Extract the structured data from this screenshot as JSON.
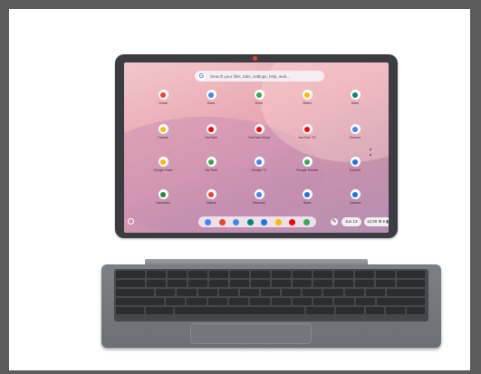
{
  "search": {
    "placeholder": "Search your files, tabs, settings, help, web..."
  },
  "apps": [
    {
      "label": "Gmail",
      "color": "#ea4335"
    },
    {
      "label": "Docs",
      "color": "#4285f4"
    },
    {
      "label": "Drive",
      "color": "#34a853"
    },
    {
      "label": "Slides",
      "color": "#fbbc04"
    },
    {
      "label": "Meet",
      "color": "#00897b"
    },
    {
      "label": "Photos",
      "color": "#fbbc04"
    },
    {
      "label": "YouTube",
      "color": "#ff0000"
    },
    {
      "label": "YouTube Music",
      "color": "#ff0000"
    },
    {
      "label": "YouTube TV",
      "color": "#ff0000"
    },
    {
      "label": "Chrome",
      "color": "#4285f4"
    },
    {
      "label": "Google Keep",
      "color": "#fbbc04"
    },
    {
      "label": "My Stuff",
      "color": "#34a853"
    },
    {
      "label": "Google TV",
      "color": "#4285f4"
    },
    {
      "label": "Google Sheets",
      "color": "#34a853"
    },
    {
      "label": "Explore",
      "color": "#1a73e8"
    },
    {
      "label": "Calculator",
      "color": "#1e8e3e"
    },
    {
      "label": "Videos",
      "color": "#ea4335"
    },
    {
      "label": "Discover",
      "color": "#4285f4"
    },
    {
      "label": "Store",
      "color": "#1a73e8"
    },
    {
      "label": "Camera",
      "color": "#1a73e8"
    }
  ],
  "shelf": {
    "pinned": [
      {
        "name": "chrome-icon",
        "color": "#4285f4"
      },
      {
        "name": "gmail-icon",
        "color": "#ea4335"
      },
      {
        "name": "docs-icon",
        "color": "#4285f4"
      },
      {
        "name": "meet-icon",
        "color": "#00897b"
      },
      {
        "name": "files-icon",
        "color": "#1a73e8"
      },
      {
        "name": "photos-icon",
        "color": "#fbbc04"
      },
      {
        "name": "youtube-icon",
        "color": "#ff0000"
      },
      {
        "name": "play-store-icon",
        "color": "#34a853"
      }
    ],
    "date": "Jun 13",
    "status": "12:30 ⚙ ▾ ▮"
  },
  "keyboard": {
    "rows": 5
  }
}
